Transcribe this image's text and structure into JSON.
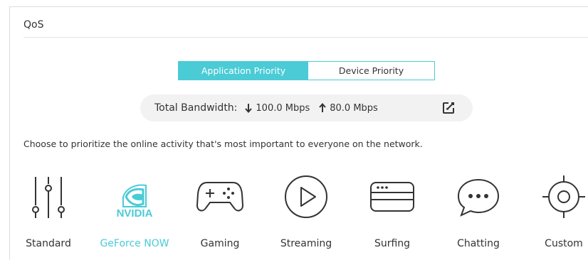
{
  "section": {
    "title": "QoS"
  },
  "tabs": [
    {
      "label": "Application Priority",
      "active": true
    },
    {
      "label": "Device Priority",
      "active": false
    }
  ],
  "bandwidth": {
    "label": "Total Bandwidth:",
    "download": "100.0 Mbps",
    "upload": "80.0 Mbps",
    "download_icon": "arrow-down-icon",
    "upload_icon": "arrow-up-icon",
    "edit_icon": "edit-icon"
  },
  "hint": "Choose to prioritize the online activity that's most important to everyone on the network.",
  "activities": [
    {
      "label": "Standard",
      "icon": "sliders-icon",
      "selected": false
    },
    {
      "label": "GeForce NOW",
      "icon": "nvidia-logo",
      "logo_text": "NVIDIA",
      "selected": true
    },
    {
      "label": "Gaming",
      "icon": "gamepad-icon",
      "selected": false
    },
    {
      "label": "Streaming",
      "icon": "play-icon",
      "selected": false
    },
    {
      "label": "Surfing",
      "icon": "browser-icon",
      "selected": false
    },
    {
      "label": "Chatting",
      "icon": "chat-bubble-icon",
      "selected": false
    },
    {
      "label": "Custom",
      "icon": "custom-gear-icon",
      "selected": false
    }
  ],
  "colors": {
    "accent": "#4acbd6",
    "icon": "#333333",
    "text": "#333333",
    "pill_bg": "#f2f2f2"
  }
}
